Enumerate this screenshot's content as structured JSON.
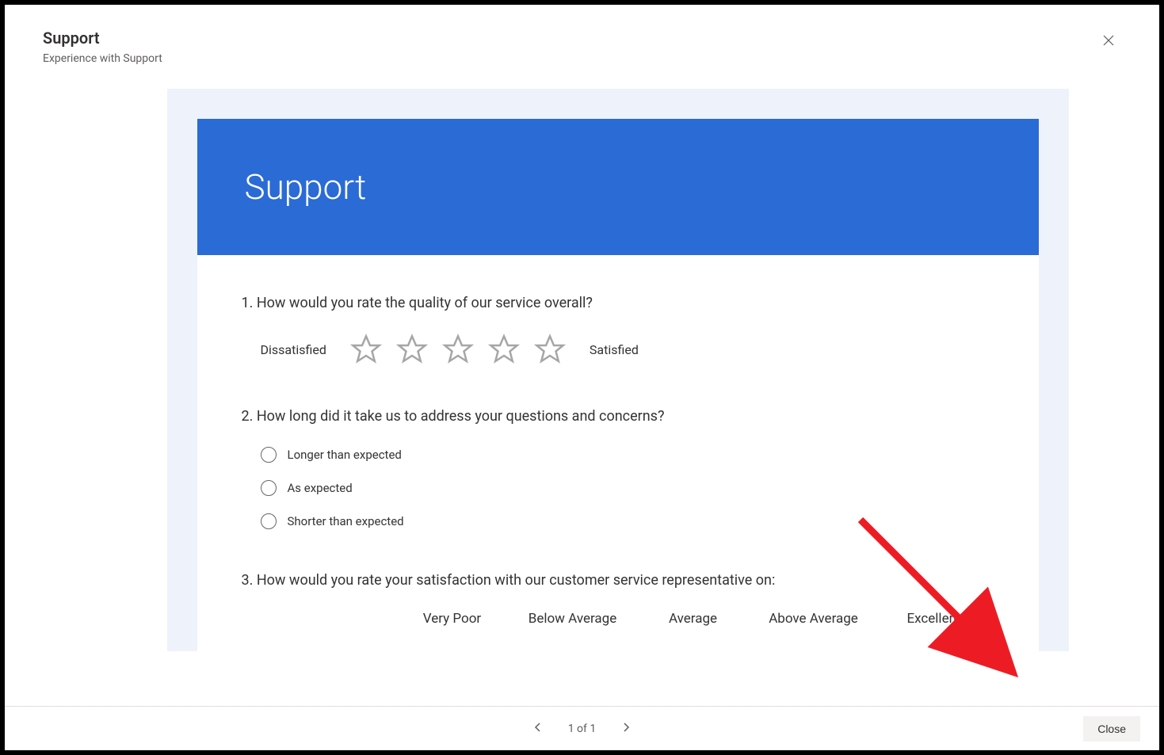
{
  "modal": {
    "title": "Support",
    "subtitle": "Experience with Support"
  },
  "survey": {
    "heroTitle": "Support",
    "q1": {
      "text": "1. How would you rate the quality of our service overall?",
      "lowLabel": "Dissatisfied",
      "highLabel": "Satisfied"
    },
    "q2": {
      "text": "2. How long did it take us to address your questions and concerns?",
      "options": [
        "Longer than expected",
        "As expected",
        "Shorter than expected"
      ]
    },
    "q3": {
      "text": "3. How would you rate your satisfaction with our customer service representative on:",
      "columns": [
        "Very Poor",
        "Below Average",
        "Average",
        "Above Average",
        "Excellent"
      ]
    }
  },
  "footer": {
    "pageText": "1 of 1",
    "closeLabel": "Close"
  }
}
